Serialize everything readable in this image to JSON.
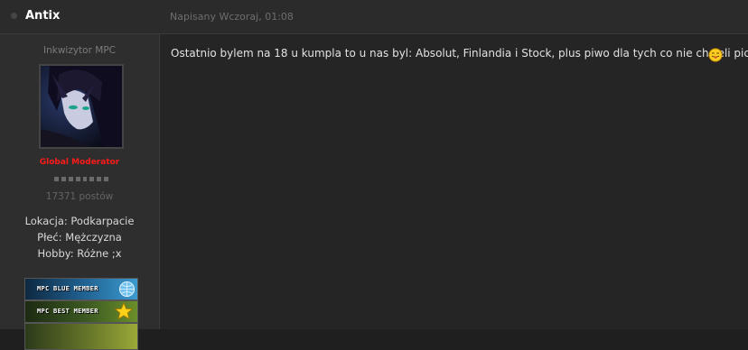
{
  "post": {
    "author": "Antix",
    "date": "Napisany Wczoraj, 01:08",
    "message": "Ostatnio bylem na 18 u kumpla to u nas byl: Absolut, Finlandia i Stock, plus piwo dla tych co nie chcieli pic",
    "smiley_icon": "tongue-out-smiley-icon"
  },
  "profile": {
    "rank_title": "Inkwizytor MPC",
    "group": "Global Moderator",
    "group_color": "#ff1a1a",
    "rank_pips": 8,
    "post_count": "17371 postów",
    "location": "Lokacja: Podkarpacie",
    "gender": "Płeć: Mężczyzna",
    "hobby": "Hobby: Różne ;x",
    "avatar_icon": "anime-character-avatar",
    "badges": [
      {
        "label": "MPC BLUE MEMBER",
        "icon": "globe-icon"
      },
      {
        "label": "MPC BEST MEMBER",
        "icon": "star-icon"
      },
      {
        "label": "",
        "icon": "badge-image"
      }
    ]
  }
}
